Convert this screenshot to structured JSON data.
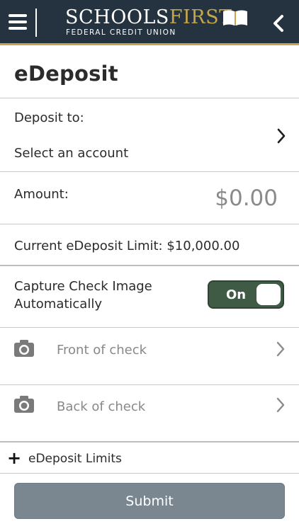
{
  "header": {
    "logo_schools": "SCHOOLS",
    "logo_first": "FIRST",
    "logo_subtitle": "FEDERAL CREDIT UNION",
    "menu_icon": "hamburger-menu-icon",
    "back_icon": "chevron-left-icon",
    "background_color": "#24333f",
    "accent_color": "#c7a54a"
  },
  "page": {
    "title": "eDeposit"
  },
  "deposit_to": {
    "label": "Deposit to:",
    "value": "Select an account"
  },
  "amount": {
    "label": "Amount:",
    "value": "$0.00"
  },
  "limit_text": "Current eDeposit Limit: $10,000.00",
  "capture": {
    "label_line1": "Capture Check Image",
    "label_line2": "Automatically",
    "toggle_label": "On",
    "toggle_on": true,
    "toggle_color": "#3f5a45"
  },
  "checks": {
    "front": "Front of check",
    "back": "Back of check",
    "icon": "camera-icon"
  },
  "limits_link": {
    "plus": "+",
    "label": "eDeposit Limits"
  },
  "submit": {
    "label": "Submit",
    "color": "#7a8791"
  }
}
